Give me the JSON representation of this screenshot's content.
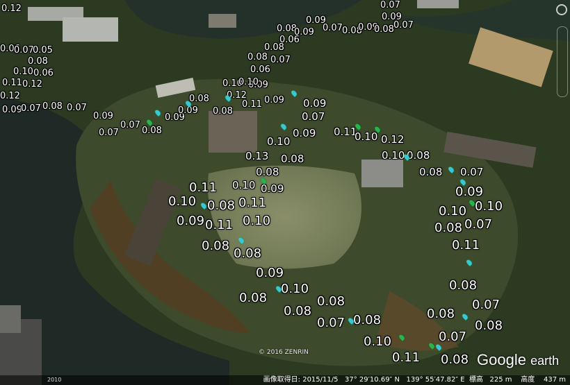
{
  "map": {
    "copyright": "© 2016 ZENRIN",
    "logo_google": "Google",
    "logo_earth": "earth",
    "status": {
      "date": "画像取得日: 2015/11/5",
      "lat": "37° 29′10.69″ N",
      "lon": "139° 55′47.82″ E",
      "elev_label": "標高",
      "elev": "225 m",
      "alt_label": "高度",
      "alt": "437 m"
    },
    "year_badge": "2010",
    "labels": [
      "0.12",
      "0.06",
      "0.07",
      "0.05",
      "0.08",
      "0.10",
      "0.06",
      "0.11",
      "0.12",
      "0.12",
      "0.09",
      "0.07",
      "0.08",
      "0.07",
      "0.09",
      "0.07",
      "0.07",
      "0.08",
      "0.09",
      "0.09",
      "0.08",
      "0.08",
      "0.10",
      "0.12",
      "0.11",
      "0.09",
      "0.10",
      "0.09",
      "0.06",
      "0.08",
      "0.07",
      "0.08",
      "0.06",
      "0.08",
      "0.09",
      "0.09",
      "0.07",
      "0.08",
      "0.09",
      "0.08",
      "0.07",
      "0.07",
      "0.09",
      "0.09",
      "0.07",
      "0.09",
      "0.11",
      "0.10",
      "0.12",
      "0.10",
      "0.08",
      "0.08",
      "0.07",
      "0.10",
      "0.08",
      "0.13",
      "0.08",
      "0.10",
      "0.09",
      "0.11",
      "0.10",
      "0.08",
      "0.11",
      "0.09",
      "0.11",
      "0.10",
      "0.09",
      "0.10",
      "0.10",
      "0.07",
      "0.11",
      "0.08",
      "0.08",
      "0.08",
      "0.09",
      "0.10",
      "0.08",
      "0.08",
      "0.08",
      "0.08",
      "0.07",
      "0.08",
      "0.08",
      "0.07",
      "0.08",
      "0.10",
      "0.07",
      "0.11",
      "0.08"
    ]
  }
}
